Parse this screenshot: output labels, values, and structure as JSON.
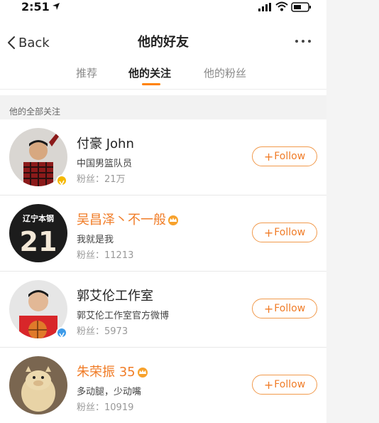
{
  "status_bar": {
    "time": "2:51"
  },
  "nav": {
    "back_label": "Back",
    "title": "他的好友"
  },
  "tabs": [
    {
      "label": "推荐",
      "active": false
    },
    {
      "label": "他的关注",
      "active": true
    },
    {
      "label": "他的粉丝",
      "active": false
    }
  ],
  "section": {
    "title": "他的全部关注"
  },
  "follow_label": "Follow",
  "users": [
    {
      "name": "付豪 John",
      "name_color": "default",
      "bio": "中国男篮队员",
      "fans": "粉丝：21万",
      "verified": "gold"
    },
    {
      "name": "吴昌泽丶不一般",
      "name_color": "orange",
      "bio": "我就是我",
      "fans": "粉丝：11213",
      "verified": "none",
      "avatar_text_top": "辽宁本钢",
      "avatar_number": "21"
    },
    {
      "name": "郭艾伦工作室",
      "name_color": "default",
      "bio": "郭艾伦工作室官方微博",
      "fans": "粉丝：5973",
      "verified": "blue"
    },
    {
      "name": "朱荣振 35",
      "name_color": "orange",
      "bio": "多动腿，少动嘴",
      "fans": "粉丝：10919",
      "verified": "none"
    }
  ],
  "colors": {
    "accent": "#ff8200",
    "orange_name": "#f07c27",
    "verified_gold": "#f5b800",
    "verified_blue": "#3d9be9"
  }
}
